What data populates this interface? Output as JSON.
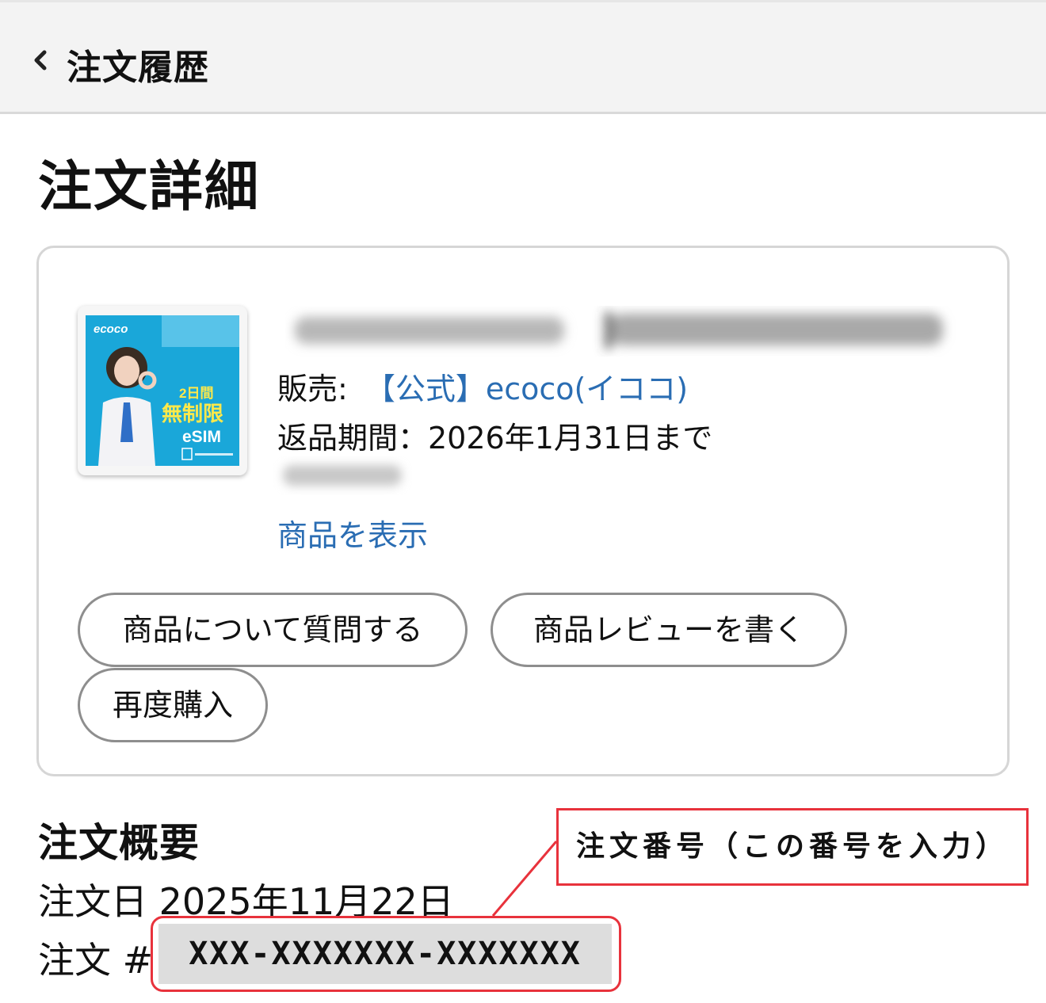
{
  "header": {
    "back_icon": "chevron-left-icon",
    "title": "注文履歴"
  },
  "page": {
    "title": "注文詳細"
  },
  "product": {
    "image": {
      "brand": "ecoco",
      "badge_top": "2日間",
      "badge_main": "無制限",
      "badge_sub": "eSIM"
    },
    "seller_label": "販売:",
    "seller_name": "【公式】ecoco(イココ)",
    "return_period": "返品期間：2026年1月31日まで",
    "view_link": "商品を表示",
    "buttons": {
      "ask": "商品について質問する",
      "review": "商品レビューを書く",
      "rebuy": "再度購入"
    }
  },
  "summary": {
    "heading": "注文概要",
    "order_date": "注文日 2025年11月22日",
    "order_number_label": "注文 #",
    "order_number": "XXX-XXXXXXX-XXXXXXX"
  },
  "annotation": {
    "callout": "注文番号（この番号を入力）",
    "color": "#e8323c"
  },
  "colors": {
    "link": "#2a6db3",
    "header_bg": "#f3f3f3"
  }
}
